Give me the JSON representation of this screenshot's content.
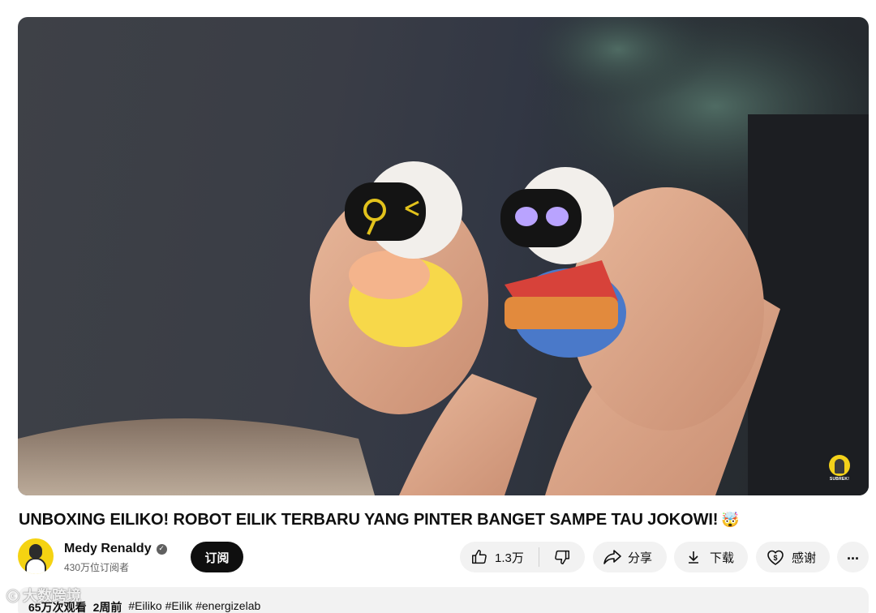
{
  "video": {
    "channel_watermark_text": "SUBREK!"
  },
  "title": "UNBOXING EILIKO! ROBOT EILIK TERBARU YANG PINTER BANGET SAMPE TAU JOKOWI!",
  "title_emoji": "🤯",
  "owner": {
    "channel_name": "Medy Renaldy",
    "verified_icon": "check-circle-icon",
    "subscribers": "430万位订阅者",
    "subscribe_label": "订阅"
  },
  "actions": {
    "like_count": "1.3万",
    "share_label": "分享",
    "download_label": "下载",
    "thanks_label": "感谢",
    "more_label": "..."
  },
  "description": {
    "views": "65万次观看",
    "posted": "2周前",
    "hashtags": [
      "#Eiliko",
      "#Eilik",
      "#energizelab"
    ]
  },
  "overlay": {
    "logo_text": "大数跨境",
    "logo_mark": "ⓒ"
  },
  "colors": {
    "subscribe_bg": "#0f0f0f",
    "pill_bg": "#f2f2f2",
    "avatar_bg": "#f5d312"
  }
}
